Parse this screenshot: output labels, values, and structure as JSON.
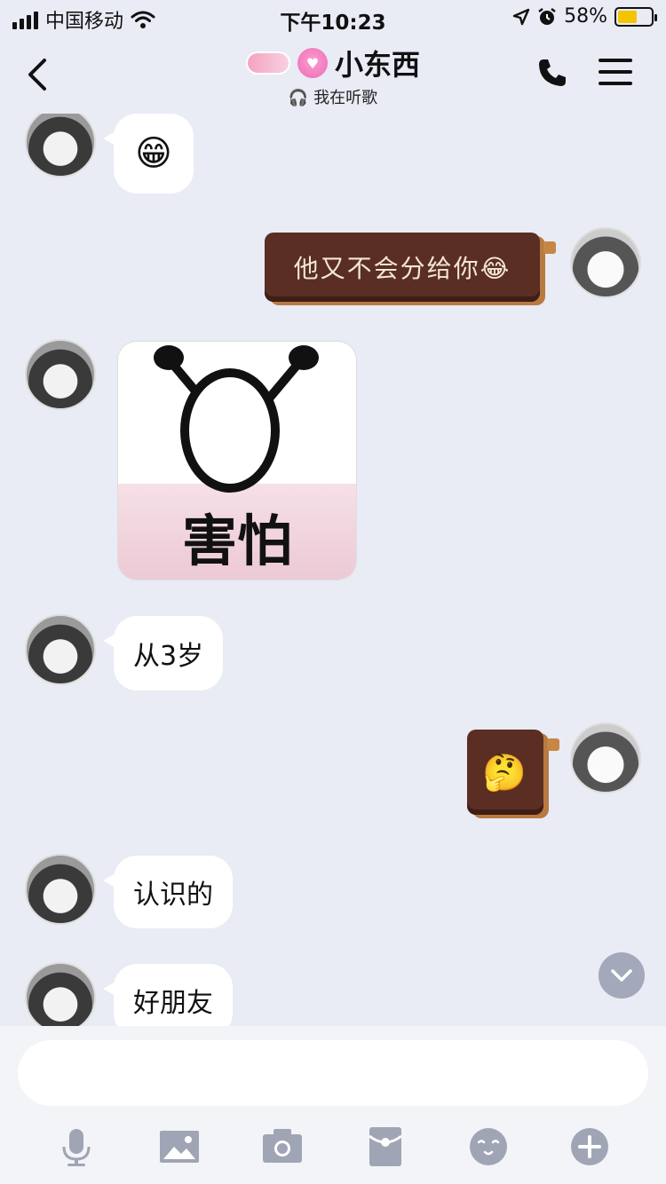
{
  "status_bar": {
    "carrier": "中国移动",
    "time": "下午10:23",
    "battery": "58%",
    "battery_level": 0.58
  },
  "header": {
    "title": "小东西",
    "subtitle": "我在听歌",
    "back_icon": "chevron-left-icon",
    "call_icon": "phone-icon",
    "menu_icon": "menu-icon"
  },
  "messages": [
    {
      "side": "left",
      "type": "emoji",
      "text": "😁"
    },
    {
      "side": "right",
      "type": "text",
      "text": "他又不会分给你😂"
    },
    {
      "side": "left",
      "type": "sticker",
      "caption": "害怕"
    },
    {
      "side": "left",
      "type": "text",
      "text": "从3岁"
    },
    {
      "side": "right",
      "type": "emoji",
      "text": "🤔"
    },
    {
      "side": "left",
      "type": "text",
      "text": "认识的"
    },
    {
      "side": "left",
      "type": "text",
      "text": "好朋友"
    }
  ],
  "input": {
    "value": "",
    "placeholder": ""
  },
  "toolbar": [
    "microphone-icon",
    "image-icon",
    "camera-icon",
    "red-packet-icon",
    "emoji-icon",
    "plus-icon"
  ],
  "colors": {
    "background": "#e9ebf5",
    "bubble": "#ffffff",
    "chocolate_bubble": "#5a2e22",
    "battery": "#f5c400"
  }
}
